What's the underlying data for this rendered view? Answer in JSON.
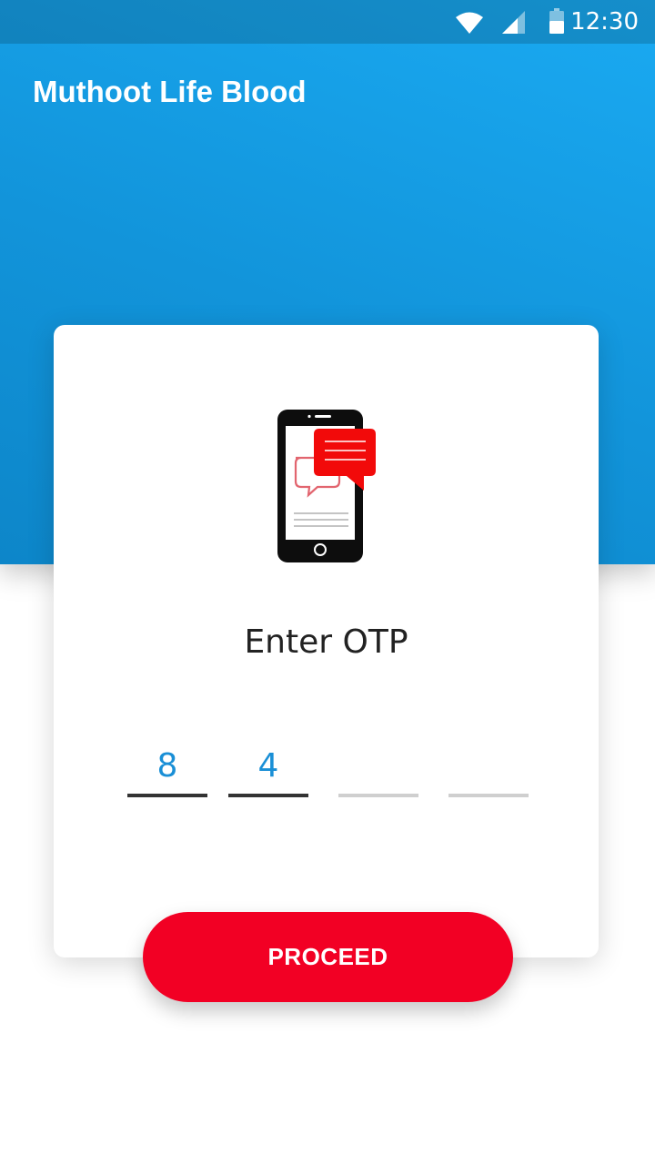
{
  "status_bar": {
    "time": "12:30",
    "icons": [
      "wifi-icon",
      "signal-icon",
      "battery-icon"
    ]
  },
  "app_bar": {
    "title": "Muthoot Life Blood"
  },
  "otp_card": {
    "illustration": "phone-sms-icon",
    "heading": "Enter OTP",
    "digits": [
      "8",
      "4",
      "",
      ""
    ]
  },
  "actions": {
    "proceed_label": "PROCEED"
  },
  "colors": {
    "header_blue": "#1294da",
    "accent_red": "#f20024",
    "digit_blue": "#1a8fd6"
  }
}
